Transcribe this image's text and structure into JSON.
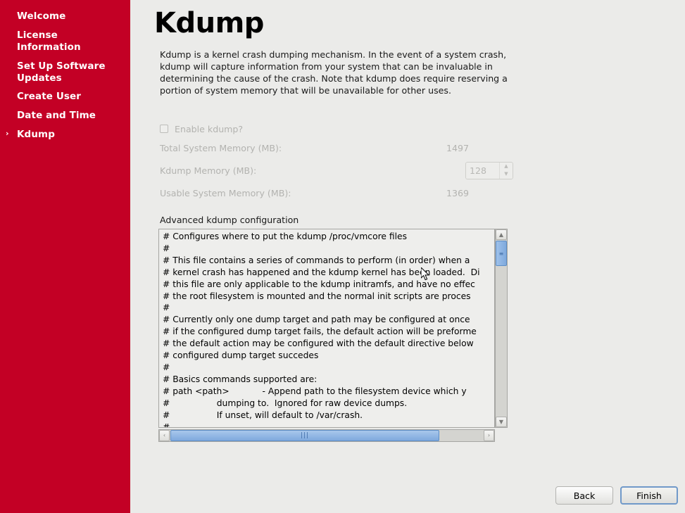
{
  "window": {
    "accent_red": "#c30025",
    "background": "#ebebe9",
    "focus_blue": "#7099c9"
  },
  "sidebar": {
    "items": [
      {
        "label": "Welcome",
        "selected": false,
        "marker": ""
      },
      {
        "label": "License Information",
        "selected": false,
        "marker": ""
      },
      {
        "label": "Set Up Software Updates",
        "selected": false,
        "marker": ""
      },
      {
        "label": "Create User",
        "selected": false,
        "marker": ""
      },
      {
        "label": "Date and Time",
        "selected": false,
        "marker": ""
      },
      {
        "label": "Kdump",
        "selected": true,
        "marker": "›"
      }
    ]
  },
  "main": {
    "title": "Kdump",
    "intro": "Kdump is a kernel crash dumping mechanism. In the event of a system crash, kdump will capture information from your system that can be invaluable in determining the cause of the crash. Note that kdump does require reserving a portion of system memory that will be unavailable for other uses.",
    "enable_checkbox": {
      "label": "Enable kdump?",
      "checked": false,
      "enabled": false
    },
    "fields": [
      {
        "label": "Total System Memory (MB):",
        "value": "1497",
        "type": "readonly",
        "enabled": false
      },
      {
        "label": "Kdump Memory (MB):",
        "value": "128",
        "type": "spinbutton",
        "enabled": false
      },
      {
        "label": "Usable System Memory (MB):",
        "value": "1369",
        "type": "readonly",
        "enabled": false
      }
    ],
    "advanced_label": "Advanced kdump configuration",
    "advanced_text": "# Configures where to put the kdump /proc/vmcore files\n#\n# This file contains a series of commands to perform (in order) when a\n# kernel crash has happened and the kdump kernel has been loaded.  Di\n# this file are only applicable to the kdump initramfs, and have no effec\n# the root filesystem is mounted and the normal init scripts are proces\n#\n# Currently only one dump target and path may be configured at once\n# if the configured dump target fails, the default action will be preforme\n# the default action may be configured with the default directive below\n# configured dump target succedes\n#\n# Basics commands supported are:\n# path <path>            - Append path to the filesystem device which y\n#                 dumping to.  Ignored for raw device dumps.\n#                 If unset, will default to /var/crash.\n#"
  },
  "scrollbars": {
    "vertical": {
      "up_arrow": "▲",
      "down_arrow": "▼",
      "grip": "≡",
      "thumb_color": "#7fa9dd"
    },
    "horizontal": {
      "left_arrow": "‹",
      "right_arrow": "›",
      "grip": "|||",
      "thumb_color": "#7fa9dd"
    }
  },
  "footer": {
    "back_label": "Back",
    "finish_label": "Finish",
    "focused_button": "Finish"
  }
}
